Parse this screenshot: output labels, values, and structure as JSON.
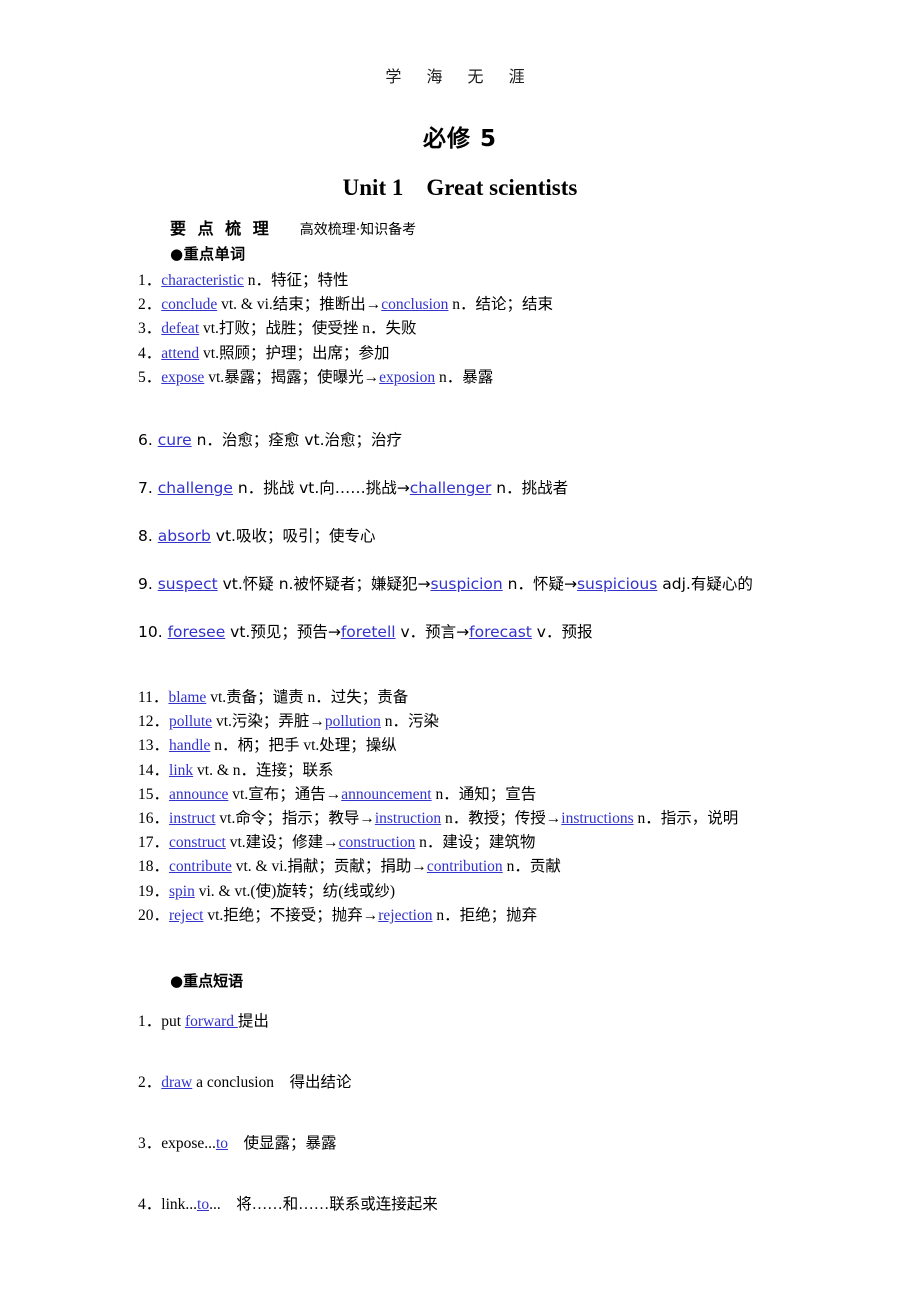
{
  "header": {
    "running_head": "学 海 无 涯",
    "book_title": "必修 5",
    "unit_title": "Unit 1    Great scientists"
  },
  "section": {
    "bar_title": "要 点 梳 理",
    "bar_subtitle": "高效梳理·知识备考",
    "words_heading": "●重点单词",
    "phrases_heading": "●重点短语"
  },
  "words_serif_first": [
    {
      "num": "1．",
      "term": "characteristic",
      "rest": " n．特征；特性"
    },
    {
      "num": "2．",
      "term": "conclude",
      "mid": " vt. & vi.结束；推断出→",
      "term2": "conclusion",
      "rest": " n．结论；结束"
    },
    {
      "num": "3．",
      "term": "defeat",
      "rest": " vt.打败；战胜；使受挫 n．失败"
    },
    {
      "num": "4．",
      "term": "attend",
      "rest": " vt.照顾；护理；出席；参加"
    },
    {
      "num": "5．",
      "term": "expose",
      "mid": " vt.暴露；揭露；使曝光→",
      "term2": "exposion",
      "rest": " n．暴露"
    }
  ],
  "words_sans": [
    {
      "num": "6.",
      "term": "cure",
      "rest": " n．治愈；痊愈 vt.治愈；治疗"
    },
    {
      "num": "7.",
      "term": "challenge",
      "mid": " n．挑战 vt.向……挑战→",
      "term2": "challenger",
      "rest": " n．挑战者"
    },
    {
      "num": "8.",
      "term": "absorb",
      "rest": " vt.吸收；吸引；使专心"
    },
    {
      "num": "9.",
      "term": "suspect",
      "mid": " vt.怀疑 n.被怀疑者；嫌疑犯→",
      "term2": "suspicion",
      "mid2": " n．怀疑→",
      "term3": "suspicious",
      "rest": " adj.有疑心的"
    },
    {
      "num": "10.",
      "term": "foresee",
      "mid": " vt.预见；预告→",
      "term2": "foretell",
      "mid2": " v．预言→",
      "term3": "forecast",
      "rest": " v．预报"
    }
  ],
  "words_serif_last": [
    {
      "num": "11．",
      "term": "blame",
      "rest": " vt.责备；谴责 n．过失；责备"
    },
    {
      "num": "12．",
      "term": "pollute",
      "mid": " vt.污染；弄脏→",
      "term2": "pollution",
      "rest": " n．污染"
    },
    {
      "num": "13．",
      "term": "handle",
      "rest": " n．柄；把手 vt.处理；操纵"
    },
    {
      "num": "14．",
      "term": "link",
      "rest": " vt. & n．连接；联系"
    },
    {
      "num": "15．",
      "term": "announce",
      "mid": " vt.宣布；通告→",
      "term2": "announcement",
      "rest": " n．通知；宣告"
    },
    {
      "num": "16．",
      "term": "instruct",
      "mid": " vt.命令；指示；教导→",
      "term2": "instruction",
      "mid2": " n．教授；传授→",
      "term3": "instructions",
      "rest": " n．指示，说明"
    },
    {
      "num": "17．",
      "term": "construct",
      "mid": " vt.建设；修建→",
      "term2": "construction",
      "rest": " n．建设；建筑物"
    },
    {
      "num": "18．",
      "term": "contribute",
      "mid": " vt. & vi.捐献；贡献；捐助→",
      "term2": "contribution",
      "rest": " n．贡献"
    },
    {
      "num": "19．",
      "term": "spin",
      "rest": " vi. & vt.(使)旋转；纺(线或纱)"
    },
    {
      "num": "20．",
      "term": "reject",
      "mid": " vt.拒绝；不接受；抛弃→",
      "term2": "rejection",
      "rest": " n．拒绝；抛弃"
    }
  ],
  "phrases": [
    {
      "num": "1．",
      "pre": "put ",
      "term": "forward ",
      "rest": "提出"
    },
    {
      "num": "2．",
      "pre": "",
      "term": "draw",
      "rest": " a conclusion　得出结论"
    },
    {
      "num": "3．",
      "pre": "expose...",
      "term": "to",
      "rest": "　使显露；暴露"
    },
    {
      "num": "4．",
      "pre": "link...",
      "term": "to",
      "rest": "...　将……和……联系或连接起来"
    }
  ],
  "colors": {
    "link": "#3333cc",
    "text": "#000000",
    "background": "#ffffff"
  }
}
